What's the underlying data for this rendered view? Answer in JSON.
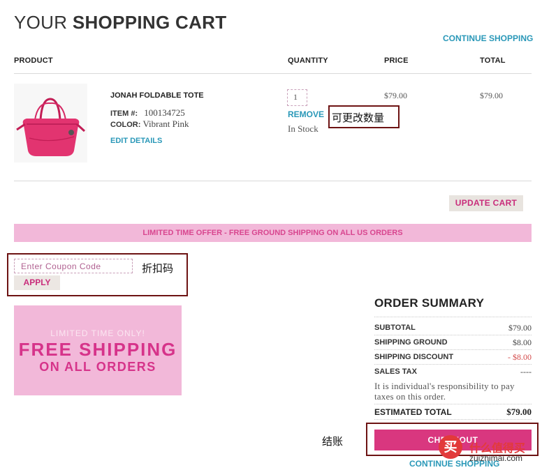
{
  "page": {
    "title_light": "YOUR ",
    "title_bold": "SHOPPING CART",
    "continue_shopping": "CONTINUE SHOPPING"
  },
  "table_header": {
    "product": "PRODUCT",
    "quantity": "QUANTITY",
    "price": "PRICE",
    "total": "TOTAL"
  },
  "cart_items": [
    {
      "name": "JONAH FOLDABLE TOTE",
      "item_label": "ITEM #:",
      "item_number": "100134725",
      "color_label": "COLOR:",
      "color": "Vibrant Pink",
      "edit_details": "EDIT DETAILS",
      "quantity": "1",
      "remove": "REMOVE",
      "stock_status": "In Stock",
      "price": "$79.00",
      "total": "$79.00",
      "image_icon": "pink-tote-bag-photo"
    }
  ],
  "update_cart": "UPDATE CART",
  "offer_banner": "LIMITED TIME OFFER - FREE GROUND SHIPPING ON ALL US ORDERS",
  "coupon": {
    "placeholder": "Enter Coupon Code",
    "apply": "APPLY"
  },
  "promo": {
    "line1": "LIMITED TIME ONLY!",
    "line2": "FREE SHIPPING",
    "line3": "ON ALL ORDERS"
  },
  "order_summary": {
    "title": "ORDER SUMMARY",
    "rows": [
      {
        "label": "SUBTOTAL",
        "value": "$79.00"
      },
      {
        "label": "SHIPPING GROUND",
        "value": "$8.00"
      },
      {
        "label": "SHIPPING DISCOUNT",
        "value": "- $8.00"
      },
      {
        "label": "SALES TAX",
        "value": "----"
      }
    ],
    "tax_note": "It is individual's responsibility to pay taxes on this order.",
    "estimated_total_label": "ESTIMATED TOTAL",
    "estimated_total_value": "$79.00",
    "checkout": "CHECKOUT"
  },
  "annotations": {
    "quantity_note": "可更改数量",
    "coupon_note": "折扣码",
    "checkout_note": "结账"
  },
  "watermark": {
    "logo_char": "买",
    "title": "什么值得买",
    "domain": "zuizhimai.com"
  },
  "colors": {
    "accent_link": "#2a98b8",
    "brand_pink": "#d9377f",
    "banner_pink": "#f2b8d9",
    "annotation_border": "#6d1313"
  }
}
